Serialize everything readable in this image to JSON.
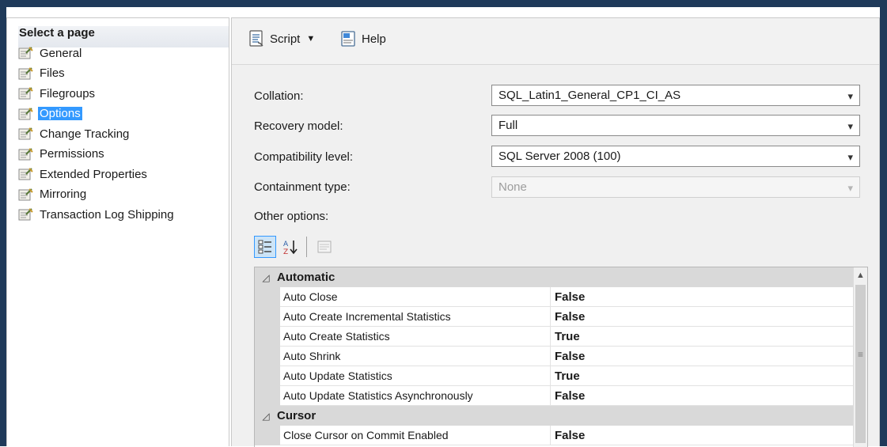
{
  "left_pane": {
    "header": "Select a page",
    "items": [
      {
        "label": "General",
        "selected": false
      },
      {
        "label": "Files",
        "selected": false
      },
      {
        "label": "Filegroups",
        "selected": false
      },
      {
        "label": "Options",
        "selected": true
      },
      {
        "label": "Change Tracking",
        "selected": false
      },
      {
        "label": "Permissions",
        "selected": false
      },
      {
        "label": "Extended Properties",
        "selected": false
      },
      {
        "label": "Mirroring",
        "selected": false
      },
      {
        "label": "Transaction Log Shipping",
        "selected": false
      }
    ]
  },
  "toolbar": {
    "script_label": "Script",
    "help_label": "Help"
  },
  "fields": {
    "collation": {
      "label": "Collation:",
      "value": "SQL_Latin1_General_CP1_CI_AS"
    },
    "recovery_model": {
      "label": "Recovery model:",
      "value": "Full"
    },
    "compatibility_level": {
      "label": "Compatibility level:",
      "value": "SQL Server 2008 (100)"
    },
    "containment_type": {
      "label": "Containment type:",
      "value": "None",
      "disabled": true
    }
  },
  "other_options_label": "Other options:",
  "grid": {
    "categories": [
      {
        "name": "Automatic",
        "rows": [
          {
            "name": "Auto Close",
            "value": "False"
          },
          {
            "name": "Auto Create Incremental Statistics",
            "value": "False"
          },
          {
            "name": "Auto Create Statistics",
            "value": "True"
          },
          {
            "name": "Auto Shrink",
            "value": "False"
          },
          {
            "name": "Auto Update Statistics",
            "value": "True"
          },
          {
            "name": "Auto Update Statistics Asynchronously",
            "value": "False"
          }
        ]
      },
      {
        "name": "Cursor",
        "rows": [
          {
            "name": "Close Cursor on Commit Enabled",
            "value": "False"
          }
        ]
      }
    ]
  },
  "colors": {
    "frame": "#1f3a5a",
    "selection": "#3399ff",
    "category_band": "#d9d9d9"
  },
  "icons": {
    "page": "properties-page-icon",
    "script": "script-icon",
    "help": "help-icon",
    "categorized": "categorized-view-icon",
    "alphabetical": "sort-alphabetical-icon",
    "property_pages": "property-pages-icon"
  }
}
